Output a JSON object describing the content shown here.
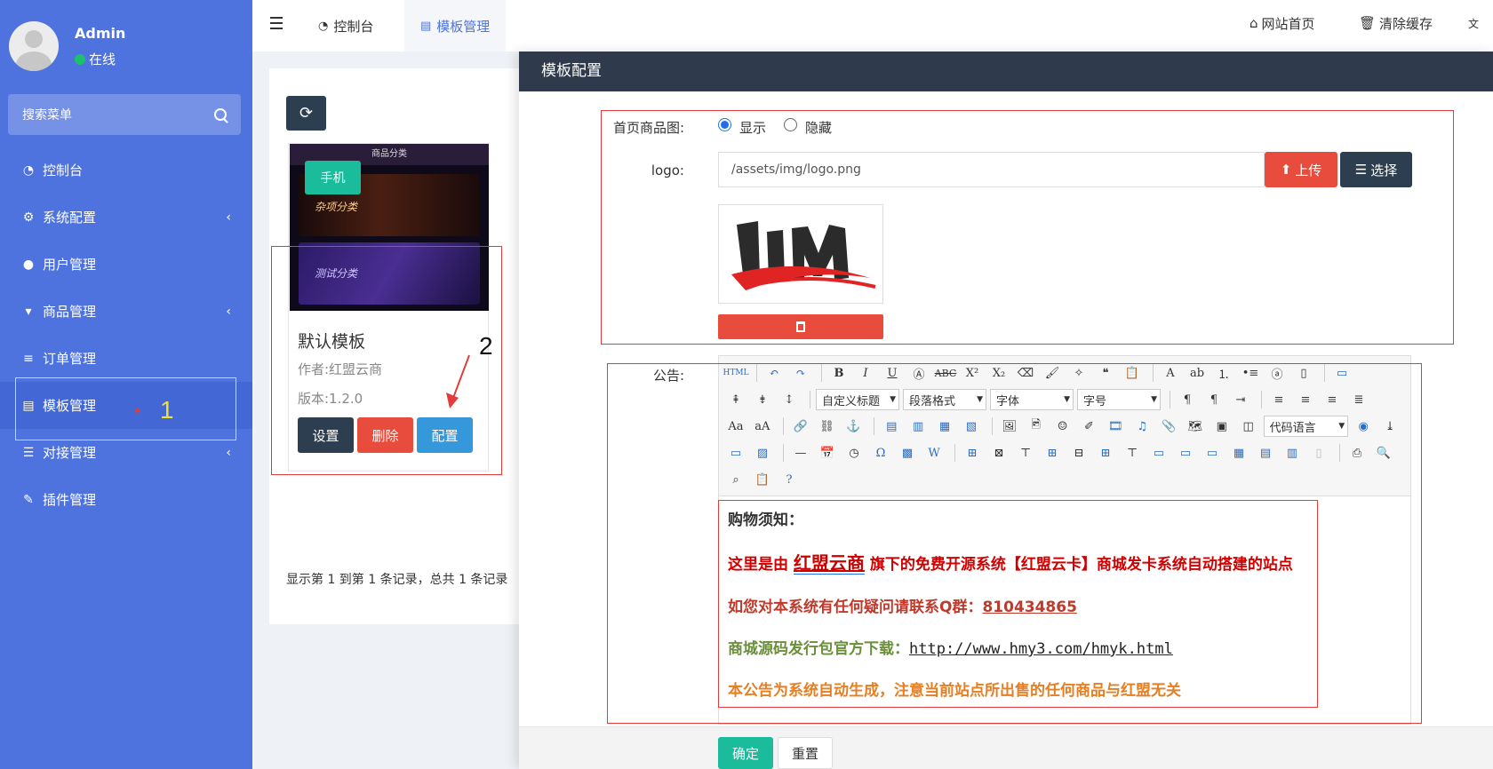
{
  "sidebar": {
    "user_name": "Admin",
    "user_status": "在线",
    "search_placeholder": "搜索菜单",
    "items": [
      {
        "label": "控制台",
        "icon": "dashboard-icon"
      },
      {
        "label": "系统配置",
        "icon": "gear-icon"
      },
      {
        "label": "用户管理",
        "icon": "user-icon"
      },
      {
        "label": "商品管理",
        "icon": "cart-icon"
      },
      {
        "label": "订单管理",
        "icon": "list-icon"
      },
      {
        "label": "模板管理",
        "icon": "template-icon"
      },
      {
        "label": "对接管理",
        "icon": "sliders-icon"
      },
      {
        "label": "插件管理",
        "icon": "plug-icon"
      }
    ]
  },
  "topbar": {
    "tabs": [
      {
        "label": "控制台"
      },
      {
        "label": "模板管理"
      }
    ],
    "links": {
      "home": "网站首页",
      "clear_cache": "清除缓存"
    }
  },
  "template_card": {
    "badge": "手机",
    "thumb_header": "商品分类",
    "thumb_item1": "杂项分类",
    "thumb_item2": "测试分类",
    "name": "默认模板",
    "author": "作者:红盟云商",
    "version": "版本:1.2.0",
    "buttons": {
      "settings": "设置",
      "delete": "删除",
      "config": "配置"
    }
  },
  "records_info": "显示第 1 到第 1 条记录，总共 1 条记录",
  "annotations": {
    "one": "1",
    "two": "2"
  },
  "modal": {
    "title": "模板配置",
    "fields": {
      "home_image_label": "首页商品图:",
      "show_label": "显示",
      "hide_label": "隐藏",
      "home_image_value": "显示",
      "logo_label": "logo:",
      "logo_value": "/assets/img/logo.png",
      "upload_label": "上传",
      "choose_label": "选择",
      "notice_label": "公告:"
    },
    "editor": {
      "toolbar_selects": {
        "custom_title": "自定义标题",
        "paragraph": "段落格式",
        "font": "字体",
        "size": "字号",
        "code_lang": "代码语言"
      },
      "content": {
        "heading": "购物须知：",
        "line1_prefix": "这里是由",
        "line1_brand": "红盟云商",
        "line1_suffix": "旗下的免费开源系统【红盟云卡】商城发卡系统自动搭建的站点",
        "line2_prefix": "如您对本系统有任何疑问请联系Q群：",
        "line2_qq": "810434865",
        "line3_prefix": "商城源码发行包官方下载：",
        "line3_url": "http://www.hmy3.com/hmyk.html",
        "line4": "本公告为系统自动生成，注意当前站点所出售的任何商品与红盟无关"
      }
    },
    "footer": {
      "ok": "确定",
      "reset": "重置"
    }
  },
  "colors": {
    "sidebar": "#4e73df",
    "modal_header": "#2f3b4c",
    "danger": "#e74c3c",
    "primary": "#3498db",
    "success": "#1abc9c",
    "dark": "#2c3e50"
  }
}
